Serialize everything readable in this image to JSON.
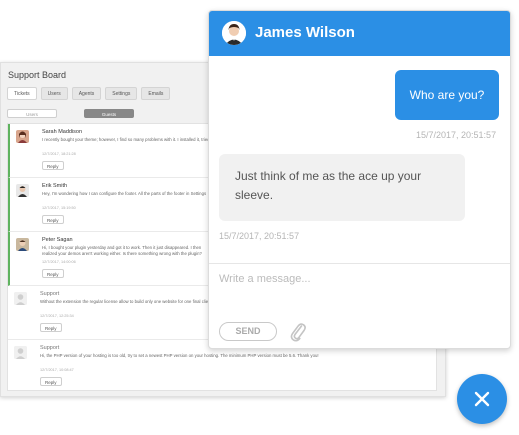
{
  "board": {
    "title": "Support Board",
    "tabs": [
      "Tickets",
      "Users",
      "Agents",
      "Settings",
      "Emails"
    ],
    "filters": [
      "Users",
      "Guests"
    ],
    "reply_label": "Reply",
    "rows": [
      {
        "name": "Sarah Maddison",
        "text": "I recently bought your theme; however, I find so many problems with it. I installed it, tried to change the background to the .png image and runs its quality, even though image is good quality",
        "time": "12/7/2017, 18:21:28"
      },
      {
        "name": "Erik Smith",
        "text": "Hey, I'm wondering how I can configure the footer. All the parts of the footer in Settings",
        "time": "12/7/2017, 15:19:50"
      },
      {
        "name": "Peter Sagan",
        "text": "Hi, I bought your plugin yesterday and got it to work. Then it just disappeared. I then realized your demos aren't working either. Is there something wrong with the plugin?",
        "time": "12/7/2017, 14:00:06"
      },
      {
        "name": "Support",
        "text": "Without the extension the regular license allow to build only one website for one final client.",
        "time": "12/7/2017, 12:25:34"
      },
      {
        "name": "Support",
        "text": "Hi, the PHP version of your hosting is too old, try to set a newest PHP version on your hosting. The minimum PHP version must be 5.6. Thank you!",
        "time": "12/7/2017, 10:08:47"
      }
    ]
  },
  "chat": {
    "contact_name": "James Wilson",
    "outgoing": {
      "text": "Who are you?",
      "time": "15/7/2017, 20:51:57"
    },
    "incoming": {
      "text": "Just think of me as the ace up your sleeve.",
      "time": "15/7/2017, 20:51:57"
    },
    "input_placeholder": "Write a message...",
    "send_label": "SEND"
  },
  "colors": {
    "accent": "#2b8fe5",
    "unread_marker": "#5fb35f"
  },
  "icons": {
    "fab": "close-icon",
    "attach": "paperclip-icon"
  }
}
